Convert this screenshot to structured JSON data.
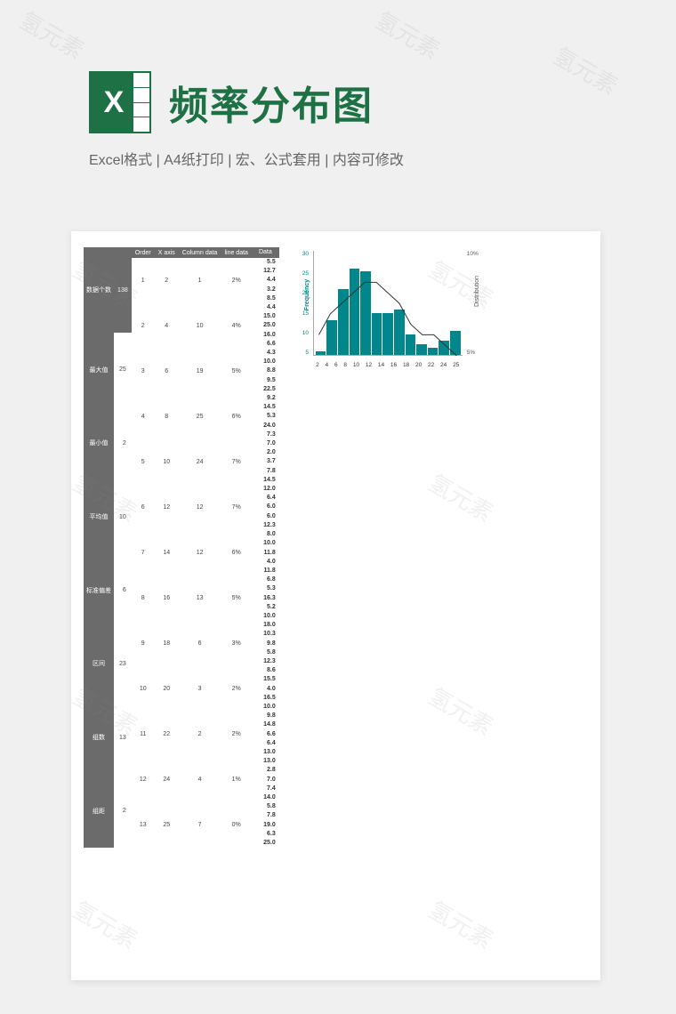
{
  "header": {
    "title": "频率分布图",
    "subtitle": "Excel格式 |  A4纸打印 | 宏、公式套用 | 内容可修改"
  },
  "watermark": "氢元素",
  "stats": {
    "header_label": "数据个数",
    "header_value": "138",
    "rows": [
      {
        "label": "最大值",
        "value": "25"
      },
      {
        "label": "最小值",
        "value": "2"
      },
      {
        "label": "平均值",
        "value": "10"
      },
      {
        "label": "标准偏差",
        "value": "6"
      },
      {
        "label": "区间",
        "value": "23"
      },
      {
        "label": "组数",
        "value": "13"
      },
      {
        "label": "组距",
        "value": "2"
      }
    ]
  },
  "table": {
    "headers": [
      "Order",
      "X axis",
      "Column data",
      "line data"
    ],
    "rows": [
      [
        "1",
        "2",
        "1",
        "2%"
      ],
      [
        "2",
        "4",
        "10",
        "4%"
      ],
      [
        "3",
        "6",
        "19",
        "5%"
      ],
      [
        "4",
        "8",
        "25",
        "6%"
      ],
      [
        "5",
        "10",
        "24",
        "7%"
      ],
      [
        "6",
        "12",
        "12",
        "7%"
      ],
      [
        "7",
        "14",
        "12",
        "6%"
      ],
      [
        "8",
        "16",
        "13",
        "5%"
      ],
      [
        "9",
        "18",
        "6",
        "3%"
      ],
      [
        "10",
        "20",
        "3",
        "2%"
      ],
      [
        "11",
        "22",
        "2",
        "2%"
      ],
      [
        "12",
        "24",
        "4",
        "1%"
      ],
      [
        "13",
        "25",
        "7",
        "0%"
      ]
    ]
  },
  "data_column": {
    "header": "Data",
    "values": [
      "5.5",
      "12.7",
      "4.4",
      "3.2",
      "8.5",
      "4.4",
      "15.0",
      "25.0",
      "16.0",
      "6.6",
      "4.3",
      "10.0",
      "8.8",
      "9.5",
      "22.5",
      "9.2",
      "14.5",
      "5.3",
      "24.0",
      "7.3",
      "7.0",
      "2.0",
      "3.7",
      "7.8",
      "14.5",
      "12.0",
      "6.4",
      "6.0",
      "6.0",
      "12.3",
      "8.0",
      "10.0",
      "11.8",
      "4.0",
      "11.8",
      "6.8",
      "5.3",
      "16.3",
      "5.2",
      "10.0",
      "18.0",
      "10.3",
      "9.8",
      "5.8",
      "12.3",
      "8.6",
      "15.5",
      "4.0",
      "16.5",
      "10.0",
      "9.8",
      "14.8",
      "6.6",
      "6.4",
      "13.0",
      "13.0",
      "2.8",
      "7.0",
      "7.4",
      "14.0",
      "5.8",
      "7.8",
      "19.0",
      "6.3",
      "25.0"
    ]
  },
  "chart_data": {
    "type": "bar",
    "categories": [
      "2",
      "4",
      "6",
      "8",
      "10",
      "12",
      "14",
      "16",
      "18",
      "20",
      "22",
      "24",
      "25"
    ],
    "series": [
      {
        "name": "Frequency",
        "values": [
          1,
          10,
          19,
          25,
          24,
          12,
          12,
          13,
          6,
          3,
          2,
          4,
          7
        ],
        "axis": "left"
      },
      {
        "name": "Distribution",
        "values": [
          0.02,
          0.04,
          0.05,
          0.06,
          0.07,
          0.07,
          0.06,
          0.05,
          0.03,
          0.02,
          0.02,
          0.01,
          0.0
        ],
        "axis": "right",
        "type": "line"
      }
    ],
    "yleft_label": "Frequency",
    "yright_label": "Distribution",
    "yleft_ticks": [
      "30",
      "25",
      "20",
      "15",
      "10",
      "5"
    ],
    "yright_ticks": [
      "10%",
      "5%"
    ],
    "ylim_left": [
      0,
      30
    ],
    "ylim_right": [
      0,
      0.1
    ]
  }
}
